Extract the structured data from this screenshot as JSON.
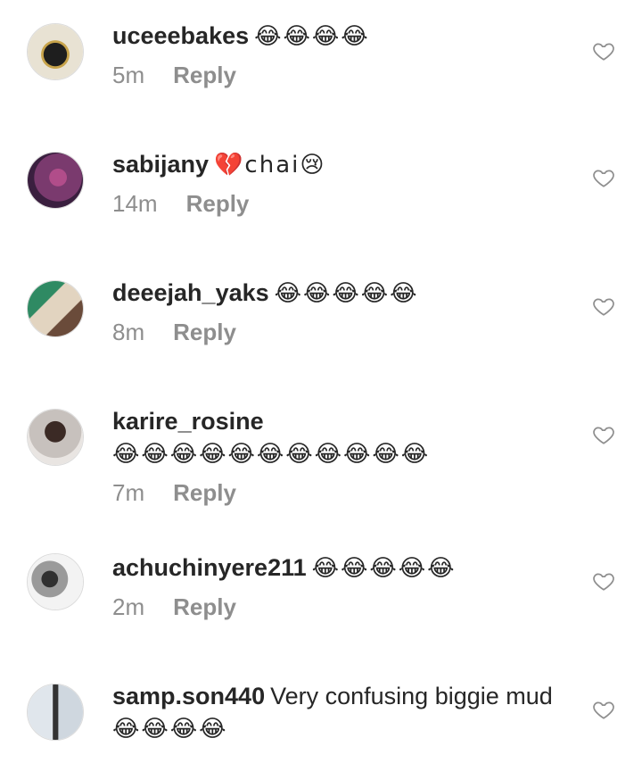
{
  "comments": [
    {
      "username": "uceeebakes",
      "text": "",
      "emoji": "😂😂😂😂",
      "time": "5m",
      "reply_label": "Reply",
      "avatar_colors": [
        "#e8e2d3",
        "#1e1e1e",
        "#c7a34a"
      ]
    },
    {
      "username": "sabijany",
      "text": "💔chai😢",
      "emoji": "",
      "time": "14m",
      "reply_label": "Reply",
      "avatar_colors": [
        "#3a1f3f",
        "#7a3a6e",
        "#b14d8a"
      ]
    },
    {
      "username": "deeejah_yaks",
      "text": "",
      "emoji": "😂😂😂😂😂",
      "time": "8m",
      "reply_label": "Reply",
      "avatar_colors": [
        "#2f8a63",
        "#e2d4c0",
        "#6a4b3a"
      ]
    },
    {
      "username": "karire_rosine",
      "text": "",
      "emoji": "😂😂😂😂😂😂😂😂😂😂😂",
      "time": "7m",
      "reply_label": "Reply",
      "avatar_colors": [
        "#c7c1bd",
        "#3b2a25",
        "#e9e5e2"
      ]
    },
    {
      "username": "achuchinyere211",
      "text": "",
      "emoji": "😂😂😂😂😂",
      "time": "2m",
      "reply_label": "Reply",
      "avatar_colors": [
        "#f3f3f3",
        "#9a9a9a",
        "#303030"
      ]
    },
    {
      "username": "samp.son440",
      "text": "Very confusing biggie mud",
      "emoji": "😂😂😂😂",
      "time": "",
      "reply_label": "",
      "avatar_colors": [
        "#e0e6ec",
        "#333333",
        "#cfd7df"
      ]
    }
  ],
  "icons": {
    "like": "heart-outline-icon"
  },
  "colors": {
    "text": "#262626",
    "meta": "#8e8e8e",
    "avatar_border": "#dbdbdb"
  }
}
